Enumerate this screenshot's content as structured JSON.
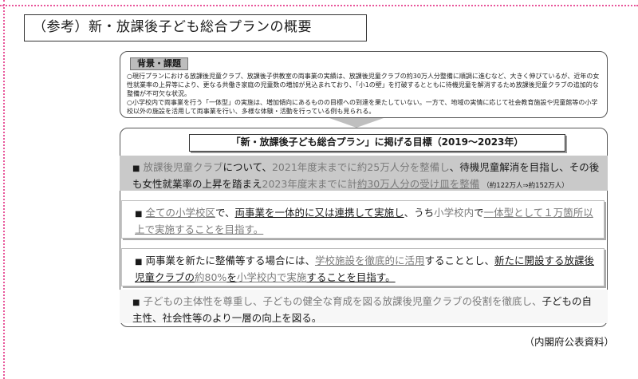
{
  "title": "（参考）新・放課後子ども総合プランの概要",
  "background": {
    "label": "背景・課題",
    "para1": "○現行プランにおける放課後児童クラブ、放課後子供教室の両事業の実績は、放課後児童クラブの約30万人分整備に順調に進むなど、大きく伸びているが、近年の女性就業率の上昇等により、更なる共働き家庭の児童数の増加が見込まれており、「小1の壁」を打破するとともに待機児童を解消するため放課後児童クラブの追加的な整備が不可欠な状況。",
    "para2": "○小学校内で両事業を行う「一体型」の実施は、増加傾向にあるものの目標への到達を果たしていない。一方で、地域の実情に応じて社会教育施設や児童館等の小学校以外の施設を活用して両事業を行い、多様な体験・活動を行っている例も見られる。"
  },
  "goals": {
    "header": "「新・放課後子ども総合プラン」に掲げる目標（2019～2023年）",
    "bullet": "■",
    "item1": {
      "a": "放課後児童クラブ",
      "b": "について、",
      "c": "2021年度末までに約25万人分を整備し",
      "d": "、",
      "e": "待機児童解消を目指し",
      "f": "、その後も女性就業率の上昇を踏まえ",
      "g": "2023年度末までに計",
      "h": "約30万人分の受け皿を整備",
      "i": "（約122万人⇒約152万人）"
    },
    "item2": {
      "a": "全ての小学校区",
      "b": "で、",
      "c": "両事業を一体的に又は連携して実施し",
      "d": "、うち",
      "e": "小学校内",
      "f": "で",
      "g": "一体型として１万箇所以上で実施する",
      "h": "ことを目指す。"
    },
    "item3": {
      "a": "両事業を新たに整備等する場合には、",
      "b": "学校施設を徹底的に活用",
      "c": "することとし、",
      "d": "新たに開設する放課後児童クラブの",
      "e": "約80%",
      "f": "を",
      "g": "小学校内で実施",
      "h": "することを目指す。"
    },
    "item4": {
      "a": "子どもの主体性を尊重し、子どもの健全な育成を図る放課後児童クラブの役割を徹底し、",
      "b": "子どもの自主性、社会性等のより一層の向上を図る。"
    }
  },
  "source": "（内閣府公表資料）"
}
